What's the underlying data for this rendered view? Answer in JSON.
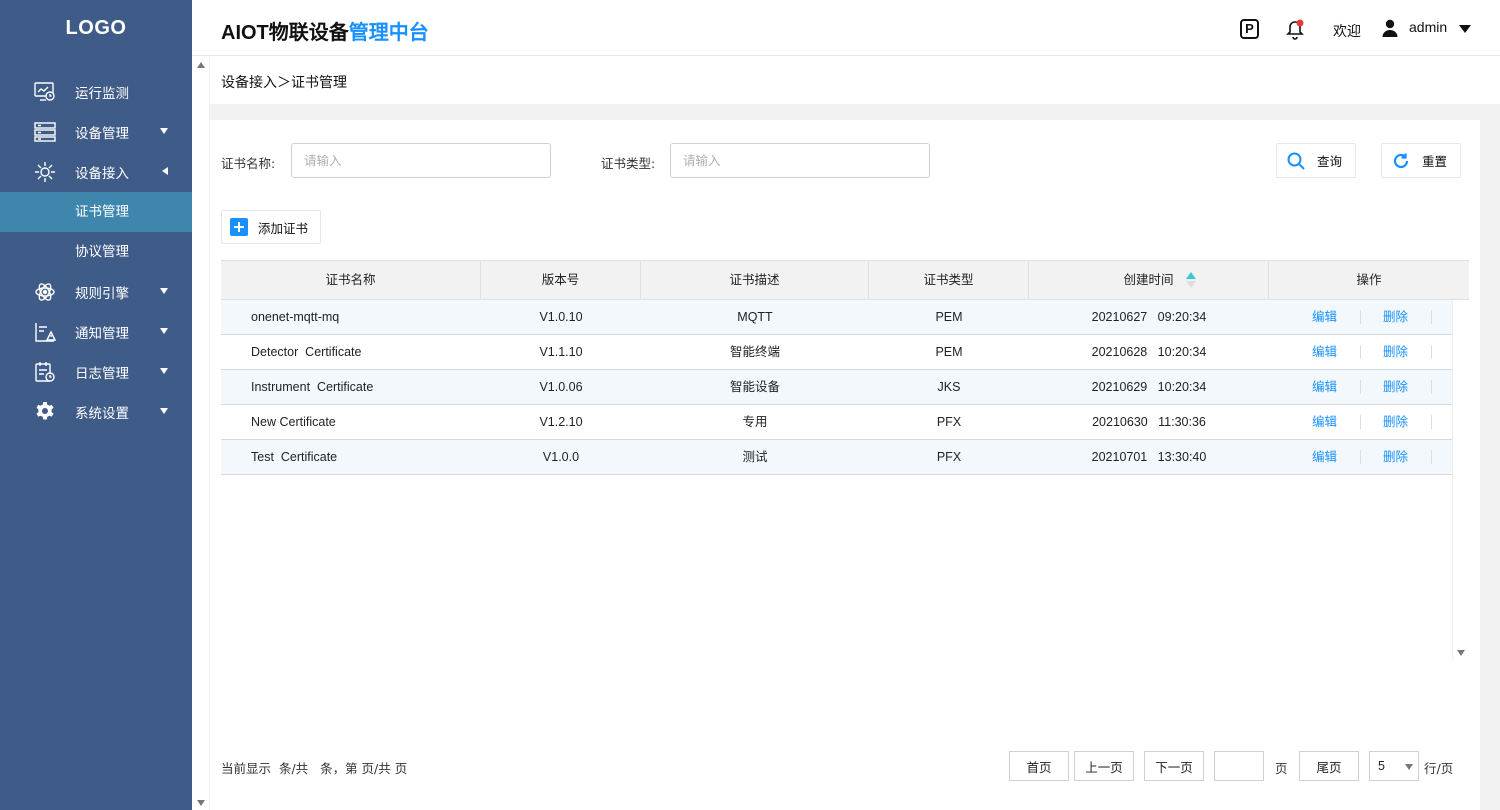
{
  "sidebar": {
    "logo": "LOGO",
    "items": [
      {
        "label": "运行监测",
        "icon": "monitor-icon"
      },
      {
        "label": "设备管理",
        "icon": "server-icon"
      },
      {
        "label": "设备接入",
        "icon": "device-access-icon"
      },
      {
        "label": "规则引擎",
        "icon": "rules-engine-icon"
      },
      {
        "label": "通知管理",
        "icon": "notification-icon"
      },
      {
        "label": "日志管理",
        "icon": "log-icon"
      },
      {
        "label": "系统设置",
        "icon": "gear-icon"
      }
    ],
    "sub_items": [
      {
        "label": "证书管理",
        "active": true
      },
      {
        "label": "协议管理",
        "active": false
      }
    ]
  },
  "header": {
    "title_main": "AIOT物联设备",
    "title_highlight": "管理中台",
    "parking_label": "P",
    "welcome": "欢迎",
    "username": "admin"
  },
  "breadcrumb": "设备接入＞证书管理",
  "filters": {
    "cert_name_label": "证书名称:",
    "cert_name_placeholder": "请输入",
    "cert_type_label": "证书类型:",
    "cert_type_placeholder": "请输入",
    "search_label": "查询",
    "reset_label": "重置"
  },
  "add_button": "添加证书",
  "table": {
    "headers": [
      "证书名称",
      "版本号",
      "证书描述",
      "证书类型",
      "创建时间",
      "操作"
    ],
    "rows": [
      {
        "name": "onenet-mqtt-mq",
        "version": "V1.0.10",
        "desc": "MQTT",
        "type": "PEM",
        "created": "20210627   09:20:34"
      },
      {
        "name": "Detector  Certificate",
        "version": "V1.1.10",
        "desc": "智能终端",
        "type": "PEM",
        "created": "20210628   10:20:34"
      },
      {
        "name": "Instrument  Certificate",
        "version": "V1.0.06",
        "desc": "智能设备",
        "type": "JKS",
        "created": "20210629   10:20:34"
      },
      {
        "name": "New Certificate",
        "version": "V1.2.10",
        "desc": "专用",
        "type": "PFX",
        "created": "20210630   11:30:36"
      },
      {
        "name": "Test  Certificate",
        "version": "V1.0.0",
        "desc": "测试",
        "type": "PFX",
        "created": "20210701   13:30:40"
      }
    ],
    "edit_label": "编辑",
    "delete_label": "删除"
  },
  "pagination": {
    "info": "当前显示  条/共   条，第 页/共 页",
    "first": "首页",
    "prev": "上一页",
    "next": "下一页",
    "page_unit": "页",
    "last": "尾页",
    "page_size": "5",
    "per_page_unit": "行/页"
  },
  "colors": {
    "sidebar_bg": "#3f5b87",
    "active_item": "#3f86ad",
    "accent": "#1890ff"
  }
}
